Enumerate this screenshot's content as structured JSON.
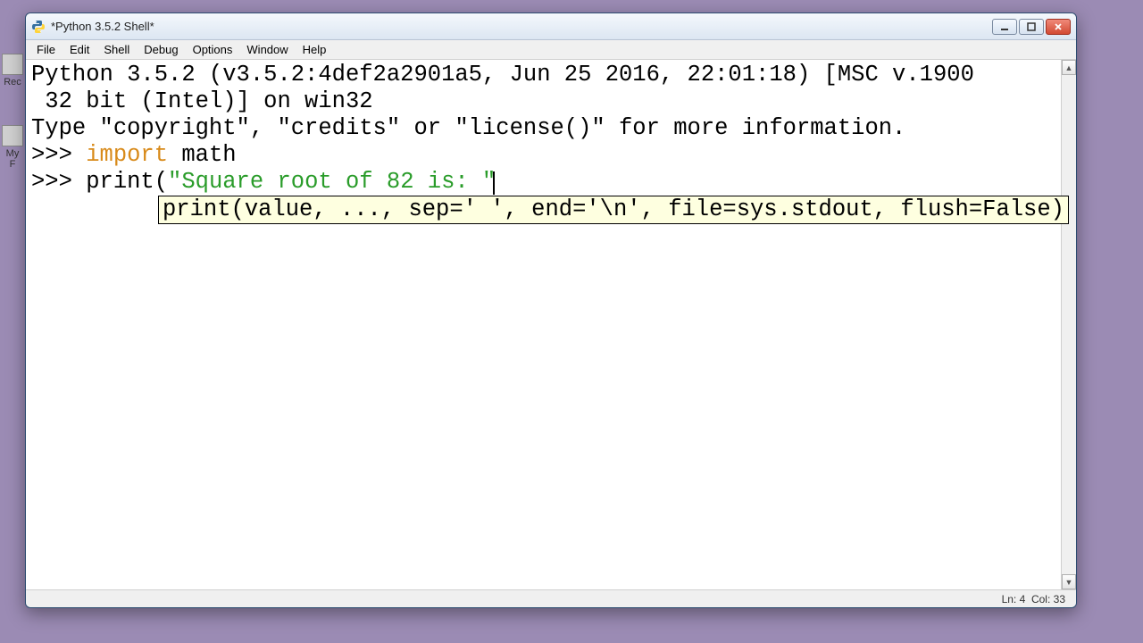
{
  "desktop": {
    "icons": [
      {
        "label": "Rec"
      },
      {
        "label": "My F"
      }
    ]
  },
  "window": {
    "title": "*Python 3.5.2 Shell*",
    "menu": [
      "File",
      "Edit",
      "Shell",
      "Debug",
      "Options",
      "Window",
      "Help"
    ],
    "status": {
      "line_label": "Ln:",
      "line": 4,
      "col_label": "Col:",
      "col": 33
    }
  },
  "shell": {
    "banner_line1": "Python 3.5.2 (v3.5.2:4def2a2901a5, Jun 25 2016, 22:01:18) [MSC v.1900 32 bit (Intel)] on win32",
    "banner_line2": "Type \"copyright\", \"credits\" or \"license()\" for more information.",
    "prompt": ">>> ",
    "lines": [
      {
        "kw": "import",
        "rest": " math"
      },
      {
        "func": "print",
        "paren": "(",
        "string": "\"Square root of 82 is: \""
      }
    ],
    "tooltip": "print(value, ..., sep=' ', end='\\n', file=sys.stdout, flush=False)"
  }
}
